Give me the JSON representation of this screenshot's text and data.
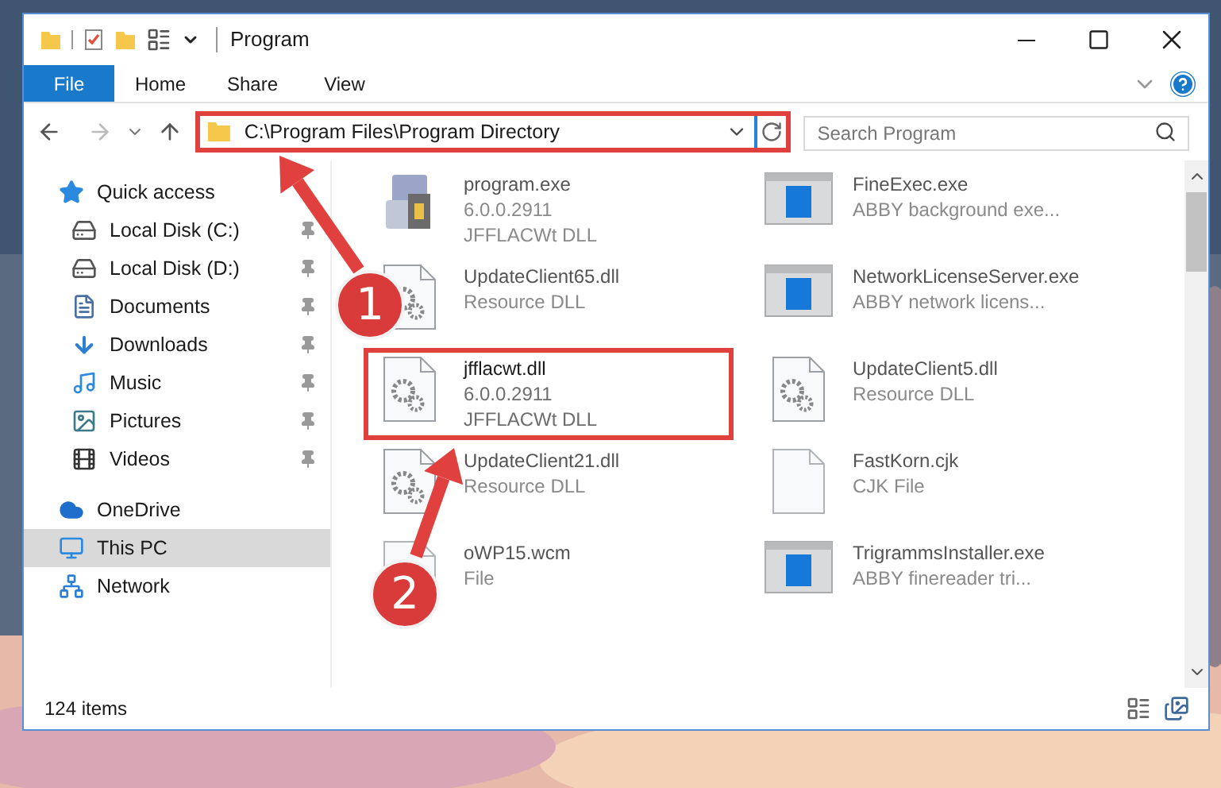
{
  "window": {
    "title": "Program"
  },
  "ribbon_tabs": [
    {
      "label": "File",
      "kind": "menu"
    },
    {
      "label": "Home",
      "kind": "tab"
    },
    {
      "label": "Share",
      "kind": "tab"
    },
    {
      "label": "View",
      "kind": "tab"
    }
  ],
  "address": {
    "path": "C:\\Program Files\\Program Directory",
    "highlighted": true
  },
  "search": {
    "placeholder": "Search Program"
  },
  "sidebar": {
    "items": [
      {
        "label": "Quick access",
        "kind": "star",
        "selected": false,
        "pinned": false,
        "children": [
          {
            "label": "Local Disk (C:)",
            "kind": "disk",
            "selected": false,
            "pinned": true
          },
          {
            "label": "Local Disk (D:)",
            "kind": "disk",
            "selected": false,
            "pinned": true
          },
          {
            "label": "Documents",
            "kind": "documents",
            "selected": false,
            "pinned": true
          },
          {
            "label": "Downloads",
            "kind": "downloads",
            "selected": false,
            "pinned": true
          },
          {
            "label": "Music",
            "kind": "music",
            "selected": false,
            "pinned": true
          },
          {
            "label": "Pictures",
            "kind": "pictures",
            "selected": false,
            "pinned": true
          },
          {
            "label": "Videos",
            "kind": "videos",
            "selected": false,
            "pinned": true
          }
        ]
      },
      {
        "label": "OneDrive",
        "kind": "cloud",
        "selected": false,
        "pinned": false
      },
      {
        "label": "This PC",
        "kind": "pc",
        "selected": true,
        "pinned": false
      },
      {
        "label": "Network",
        "kind": "network",
        "selected": false,
        "pinned": false
      }
    ]
  },
  "files": [
    {
      "name": "program.exe",
      "details": [
        "6.0.0.2911",
        "JFFLACWt DLL"
      ],
      "kind": "setup",
      "highlighted": false
    },
    {
      "name": "FineExec.exe",
      "details": [
        "ABBY background exe..."
      ],
      "kind": "app",
      "highlighted": false
    },
    {
      "name": "UpdateClient65.dll",
      "details": [
        "Resource DLL"
      ],
      "kind": "dll",
      "highlighted": false
    },
    {
      "name": "NetworkLicenseServer.exe",
      "details": [
        "ABBY network licens..."
      ],
      "kind": "app",
      "highlighted": false
    },
    {
      "name": "jfflacwt.dll",
      "details": [
        "6.0.0.2911",
        "JFFLACWt DLL"
      ],
      "kind": "dll",
      "highlighted": true
    },
    {
      "name": "UpdateClient5.dll",
      "details": [
        "Resource DLL"
      ],
      "kind": "dll",
      "highlighted": false
    },
    {
      "name": "UpdateClient21.dll",
      "details": [
        "Resource DLL"
      ],
      "kind": "dll",
      "highlighted": false
    },
    {
      "name": "FastKorn.cjk",
      "details": [
        "CJK File"
      ],
      "kind": "file",
      "highlighted": false
    },
    {
      "name": "oWP15.wcm",
      "details": [
        "File"
      ],
      "kind": "file",
      "highlighted": false
    },
    {
      "name": "TrigrammsInstaller.exe",
      "details": [
        "ABBY finereader tri..."
      ],
      "kind": "app",
      "highlighted": false
    }
  ],
  "status_bar": {
    "count": "124 items"
  },
  "annotations": [
    {
      "label": "1"
    },
    {
      "label": "2"
    }
  ]
}
